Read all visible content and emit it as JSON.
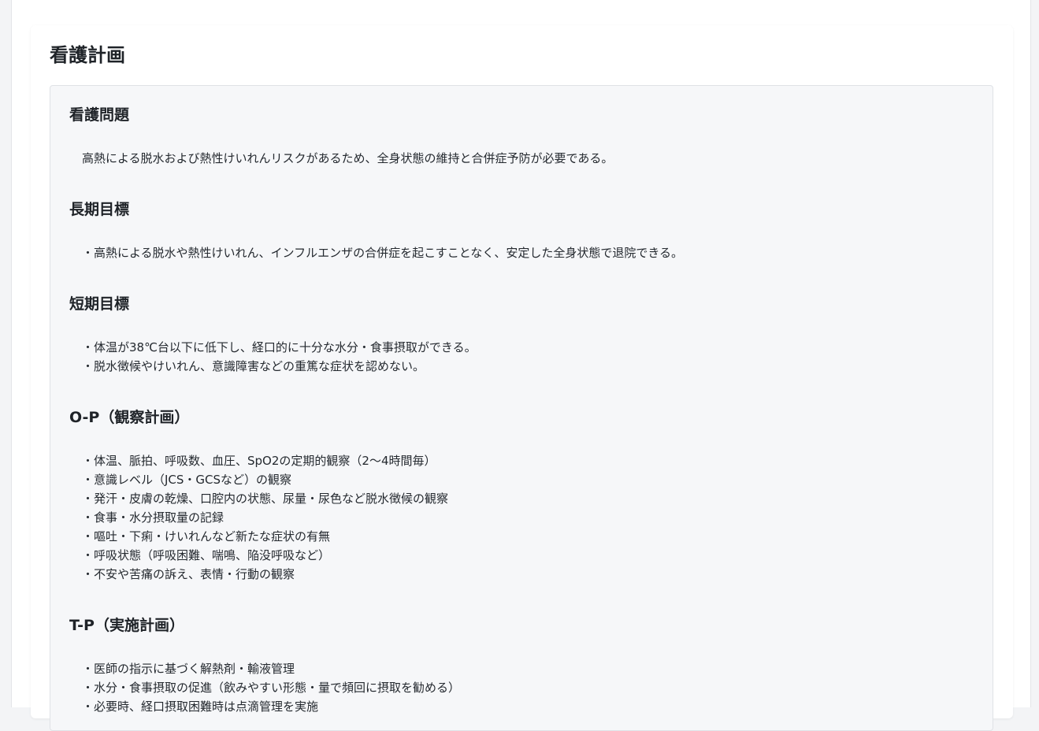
{
  "page": {
    "title": "看護計画"
  },
  "sections": {
    "problem": {
      "heading": "看護問題",
      "lines": [
        "高熱による脱水および熱性けいれんリスクがあるため、全身状態の維持と合併症予防が必要である。"
      ]
    },
    "long_term": {
      "heading": "長期目標",
      "lines": [
        "・高熱による脱水や熱性けいれん、インフルエンザの合併症を起こすことなく、安定した全身状態で退院できる。"
      ]
    },
    "short_term": {
      "heading": "短期目標",
      "lines": [
        "・体温が38℃台以下に低下し、経口的に十分な水分・食事摂取ができる。",
        "・脱水徴候やけいれん、意識障害などの重篤な症状を認めない。"
      ]
    },
    "op": {
      "heading": "O-P（観察計画）",
      "lines": [
        "・体温、脈拍、呼吸数、血圧、SpO2の定期的観察（2〜4時間毎）",
        "・意識レベル（JCS・GCSなど）の観察",
        "・発汗・皮膚の乾燥、口腔内の状態、尿量・尿色など脱水徴候の観察",
        "・食事・水分摂取量の記録",
        "・嘔吐・下痢・けいれんなど新たな症状の有無",
        "・呼吸状態（呼吸困難、喘鳴、陥没呼吸など）",
        "・不安や苦痛の訴え、表情・行動の観察"
      ]
    },
    "tp": {
      "heading": "T-P（実施計画）",
      "lines": [
        "・医師の指示に基づく解熱剤・輸液管理",
        "・水分・食事摂取の促進（飲みやすい形態・量で頻回に摂取を勧める）",
        "・必要時、経口摂取困難時は点滴管理を実施"
      ]
    }
  }
}
